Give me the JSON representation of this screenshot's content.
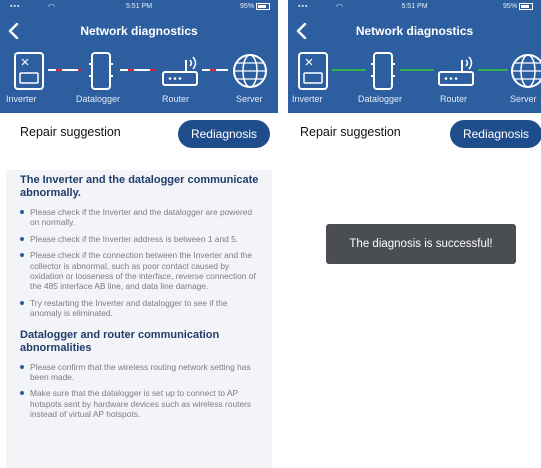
{
  "colors": {
    "header": "#2d5fa0",
    "button": "#1f4d8c",
    "link_fail": "#e0252f",
    "link_ok": "#2fb24a",
    "toast": "#4a4d52"
  },
  "left": {
    "status": {
      "time": "5:51 PM",
      "battery": "95%"
    },
    "title": "Network diagnostics",
    "nodes": [
      "Inverter",
      "Datalogger",
      "Router",
      "Server"
    ],
    "link_status": "fail",
    "repair_label": "Repair suggestion",
    "rediagnose_label": "Rediagnosis",
    "issues": [
      {
        "title": "The Inverter and the datalogger communicate abnormally.",
        "items": [
          "Please check if the Inverter and the datalogger are powered on normally.",
          "Please check if the Inverter address is between 1 and 5.",
          "Please check if the connection between the Inverter and the collector is abnormal, such as poor contact caused by oxidation or looseness of the interface, reverse connection of the 485 interface AB line, and data line damage.",
          "Try restarting the Inverter and datalogger to see if the anomaly is eliminated."
        ]
      },
      {
        "title": "Datalogger and router communication abnormalities",
        "items": [
          "Please confirm that the wireless routing network setting has been made.",
          "Make sure that the datalogger is set up to connect to AP hotspots sent by hardware devices such as wireless routers instead of virtual AP hotspots."
        ]
      }
    ]
  },
  "right": {
    "status": {
      "time": "5:51 PM",
      "battery": "95%"
    },
    "title": "Network diagnostics",
    "nodes": [
      "Inverter",
      "Datalogger",
      "Router",
      "Server"
    ],
    "link_status": "ok",
    "repair_label": "Repair suggestion",
    "rediagnose_label": "Rediagnosis",
    "toast": "The diagnosis is successful!"
  }
}
